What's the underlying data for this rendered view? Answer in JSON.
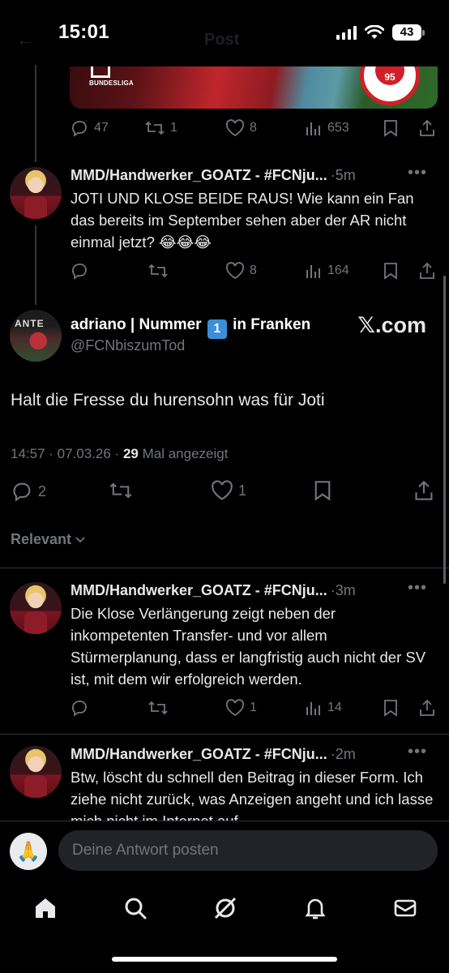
{
  "status_bar": {
    "time": "15:01",
    "battery": "43"
  },
  "header": {
    "title": "Post"
  },
  "reply_prev": {
    "comments": "47",
    "reposts": "1",
    "likes": "8",
    "views": "653"
  },
  "replies_above": [
    {
      "name": "MMD/Handwerker_GOATZ - #FCNju...",
      "time": "·5m",
      "text": "JOTI UND KLOSE BEIDE RAUS! Wie kann ein Fan das bereits im September sehen aber der AR nicht einmal jetzt? 😂😂😂",
      "comments": "",
      "reposts": "",
      "likes": "8",
      "views": "164"
    }
  ],
  "main_post": {
    "name_before": "adriano | Nummer",
    "name_emoji": "1",
    "name_after": "in Franken",
    "handle": "@FCNbiszumTod",
    "source": "𝕏.com",
    "text": "Halt die Fresse du hurensohn was für Joti",
    "time": "14:57 · 07.03.26 ·",
    "views_count": "29",
    "views_label": "Mal angezeigt",
    "replies": "2",
    "likes": "1"
  },
  "sort": {
    "label": "Relevant"
  },
  "replies_below": [
    {
      "name": "MMD/Handwerker_GOATZ - #FCNju...",
      "time": "·3m",
      "text": "Die Klose Verlängerung zeigt neben der inkompetenten Transfer- und vor allem Stürmerplanung, dass er langfristig auch nicht der SV ist, mit dem wir erfolgreich werden.",
      "likes": "1",
      "views": "14"
    },
    {
      "name": "MMD/Handwerker_GOATZ - #FCNju...",
      "time": "·2m",
      "text": "Btw, löscht du schnell den Beitrag in dieser Form. Ich ziehe nicht zurück, was Anzeigen angeht und ich lasse mich nicht im Internet auf"
    }
  ],
  "media": {
    "league_label": "BUNDESLIGA",
    "badge_text": "95"
  },
  "compose": {
    "placeholder": "Deine Antwort posten",
    "avatar_emoji": "🙏"
  },
  "nav": [
    "home-icon",
    "search-icon",
    "grok-icon",
    "notifications-icon",
    "messages-icon"
  ],
  "colors": {
    "background": "#000000",
    "text": "#e7e9ea",
    "muted": "#71767b",
    "divider": "#2f3336"
  }
}
